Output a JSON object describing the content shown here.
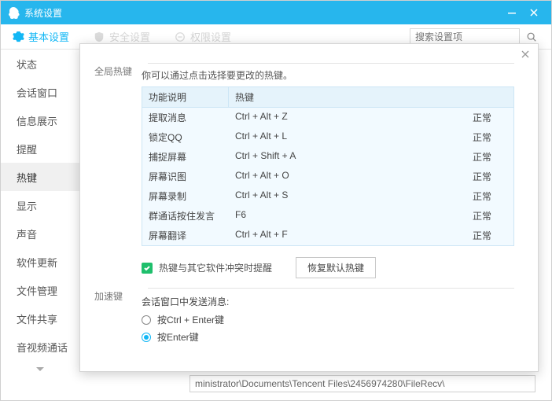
{
  "window": {
    "title": "系统设置"
  },
  "tabs": {
    "basic": "基本设置",
    "security": "安全设置",
    "permission": "权限设置"
  },
  "search": {
    "placeholder": "搜索设置项"
  },
  "sidebar": {
    "items": [
      "状态",
      "会话窗口",
      "信息展示",
      "提醒",
      "热键",
      "显示",
      "声音",
      "软件更新",
      "文件管理",
      "文件共享",
      "音视频通话"
    ],
    "activeIndex": 4
  },
  "path_field": "ministrator\\Documents\\Tencent Files\\2456974280\\FileRecv\\",
  "hotkeys": {
    "section_title": "全局热键",
    "desc": "你可以通过点击选择要更改的热键。",
    "col_func": "功能说明",
    "col_key": "热键",
    "rows": [
      {
        "func": "提取消息",
        "key": "Ctrl + Alt + Z",
        "status": "正常"
      },
      {
        "func": "锁定QQ",
        "key": "Ctrl + Alt + L",
        "status": "正常"
      },
      {
        "func": "捕捉屏幕",
        "key": "Ctrl + Shift + A",
        "status": "正常"
      },
      {
        "func": "屏幕识图",
        "key": "Ctrl + Alt + O",
        "status": "正常"
      },
      {
        "func": "屏幕录制",
        "key": "Ctrl + Alt + S",
        "status": "正常"
      },
      {
        "func": "群通话按住发言",
        "key": "F6",
        "status": "正常"
      },
      {
        "func": "屏幕翻译",
        "key": "Ctrl + Alt + F",
        "status": "正常"
      }
    ],
    "conflict_label": "热键与其它软件冲突时提醒",
    "restore_label": "恢复默认热键"
  },
  "accel": {
    "section_title": "加速键",
    "sub_label": "会话窗口中发送消息:",
    "opt_ctrl_enter": "按Ctrl + Enter键",
    "opt_enter": "按Enter键"
  }
}
